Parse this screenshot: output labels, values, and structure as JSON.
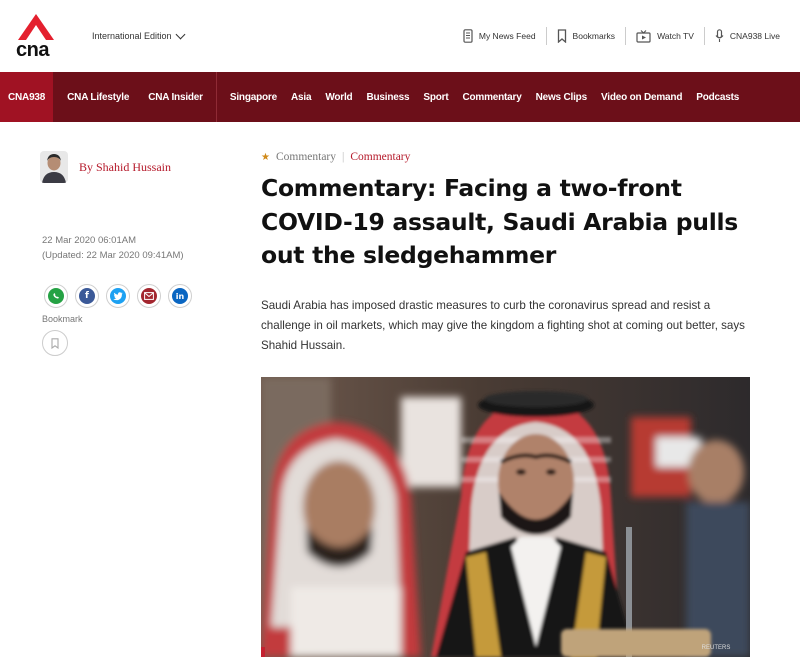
{
  "brand": {
    "logo_text": "cna",
    "accent_color": "#e4202e",
    "nav_bg": "#6c0f19"
  },
  "header": {
    "edition_label": "International Edition",
    "links": [
      {
        "label": "My News Feed",
        "icon": "phone-icon"
      },
      {
        "label": "Bookmarks",
        "icon": "bookmark-icon"
      },
      {
        "label": "Watch TV",
        "icon": "tv-icon"
      },
      {
        "label": "CNA938 Live",
        "icon": "microphone-icon"
      }
    ]
  },
  "nav": {
    "primary": [
      "CNA938",
      "CNA Lifestyle",
      "CNA Insider"
    ],
    "sections": [
      "Singapore",
      "Asia",
      "World",
      "Business",
      "Sport",
      "Commentary",
      "News Clips",
      "Video on Demand",
      "Podcasts"
    ]
  },
  "article": {
    "author": "By Shahid Hussain",
    "published": "22 Mar 2020 06:01AM",
    "updated": "(Updated: 22 Mar 2020 09:41AM)",
    "category_tag": "Commentary",
    "category_link": "Commentary",
    "title": "Commentary: Facing a two-front COVID-19 assault, Saudi Arabia pulls out the sledgehammer",
    "lede": "Saudi Arabia has imposed drastic measures to curb the coronavirus spread and resist a challenge in oil markets, which may give the kingdom a fighting shot at coming out better, says Shahid Hussain.",
    "bookmark_label": "Bookmark",
    "image_credit": "REUTERS"
  },
  "share": [
    {
      "name": "whatsapp",
      "color": "#25a244",
      "glyph": "✆"
    },
    {
      "name": "facebook",
      "color": "#3b5998",
      "glyph": "f"
    },
    {
      "name": "twitter",
      "color": "#1da1f2",
      "glyph": "t"
    },
    {
      "name": "email",
      "color": "#a3262f",
      "glyph": "✉"
    },
    {
      "name": "linkedin",
      "color": "#0a66c2",
      "glyph": "in"
    }
  ]
}
